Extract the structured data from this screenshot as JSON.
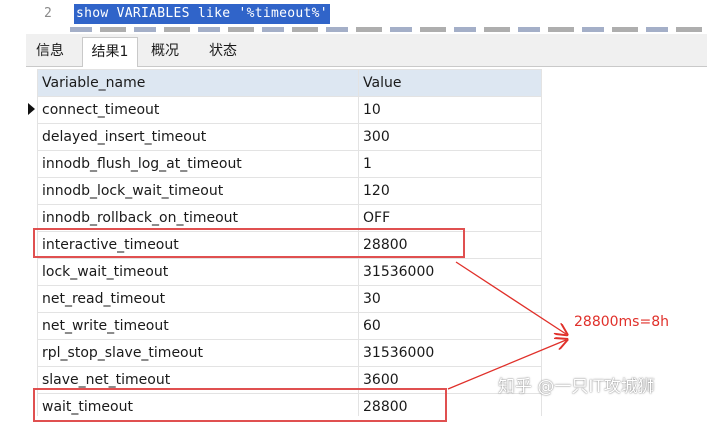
{
  "editor": {
    "line_number": "2",
    "sql_text": "show VARIABLES like '%timeout%'"
  },
  "tabs": [
    {
      "label": "信息",
      "active": false
    },
    {
      "label": "结果1",
      "active": true
    },
    {
      "label": "概况",
      "active": false
    },
    {
      "label": "状态",
      "active": false
    }
  ],
  "grid": {
    "columns": [
      "Variable_name",
      "Value"
    ],
    "rows": [
      [
        "connect_timeout",
        "10"
      ],
      [
        "delayed_insert_timeout",
        "300"
      ],
      [
        "innodb_flush_log_at_timeout",
        "1"
      ],
      [
        "innodb_lock_wait_timeout",
        "120"
      ],
      [
        "innodb_rollback_on_timeout",
        "OFF"
      ],
      [
        "interactive_timeout",
        "28800"
      ],
      [
        "lock_wait_timeout",
        "31536000"
      ],
      [
        "net_read_timeout",
        "30"
      ],
      [
        "net_write_timeout",
        "60"
      ],
      [
        "rpl_stop_slave_timeout",
        "31536000"
      ],
      [
        "slave_net_timeout",
        "3600"
      ],
      [
        "wait_timeout",
        "28800"
      ]
    ]
  },
  "annotation": {
    "note": "28800ms=8h",
    "color": "#e0302a"
  },
  "watermark": "知乎 @一只IT攻城狮"
}
